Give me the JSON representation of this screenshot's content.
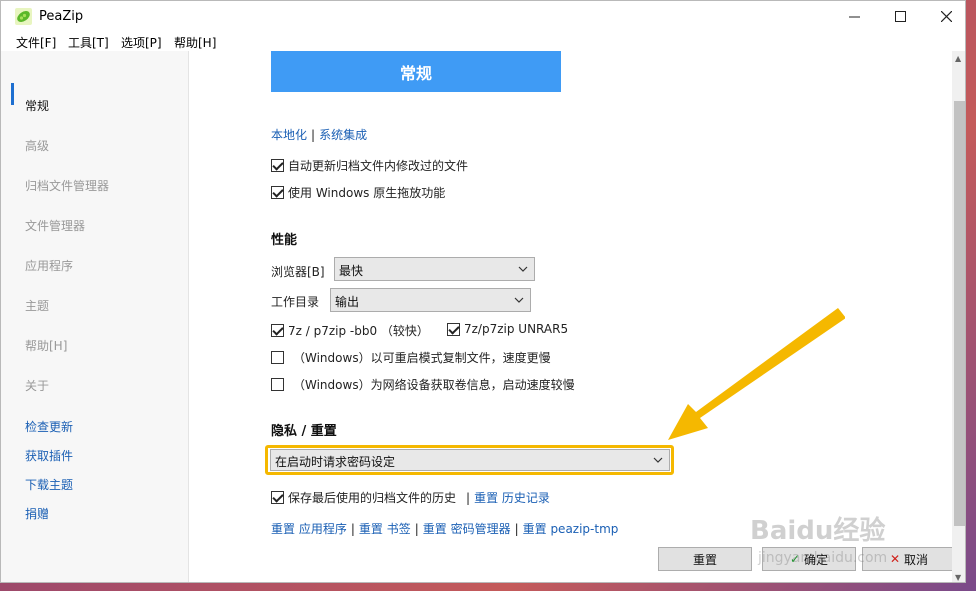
{
  "window": {
    "title": "PeaZip"
  },
  "menubar": {
    "items": [
      "文件[F]",
      "工具[T]",
      "选项[P]",
      "帮助[H]"
    ]
  },
  "sidebar": {
    "items": [
      "常规",
      "高级",
      "归档文件管理器",
      "文件管理器",
      "应用程序",
      "主题",
      "帮助[H]",
      "关于"
    ],
    "links": [
      "检查更新",
      "获取插件",
      "下载主题",
      "捐赠"
    ]
  },
  "content": {
    "header": "常规",
    "top_links": {
      "localization": "本地化",
      "separator": "|",
      "integration": "系统集成"
    },
    "general_checks": [
      {
        "label": "自动更新归档文件内修改过的文件",
        "checked": true
      },
      {
        "label": "使用 Windows 原生拖放功能",
        "checked": true
      }
    ],
    "performance": {
      "title": "性能",
      "browser_label": "浏览器[B]",
      "browser_value": "最快",
      "workdir_label": "工作目录",
      "workdir_value": "输出",
      "check_7z": {
        "label": "7z / p7zip -bb0 （较快）",
        "checked": true
      },
      "check_unrar": {
        "label": "7z/p7zip UNRAR5",
        "checked": true
      },
      "check_restart": {
        "label": "（Windows）以可重启模式复制文件，速度更慢",
        "checked": false
      },
      "check_network": {
        "label": "（Windows）为网络设备获取卷信息，启动速度较慢",
        "checked": false
      }
    },
    "privacy": {
      "title": "隐私 / 重置",
      "password_value": "在启动时请求密码设定",
      "history_check": {
        "label": "保存最后使用的归档文件的历史",
        "checked": true
      },
      "history_sep": "|",
      "reset_history": "重置 历史记录",
      "reset_links": [
        "重置 应用程序",
        "重置 书签",
        "重置 密码管理器",
        "重置 peazip-tmp"
      ],
      "reset_sep": "|"
    }
  },
  "buttons": {
    "reset": "重置",
    "ok": "确定",
    "cancel": "取消"
  },
  "watermark": {
    "brand": "Baidu经验",
    "sub": "jingyan.baidu.com"
  },
  "colors": {
    "accent": "#3f9bf5",
    "link": "#1a5fb4",
    "annotation": "#f5b800"
  }
}
